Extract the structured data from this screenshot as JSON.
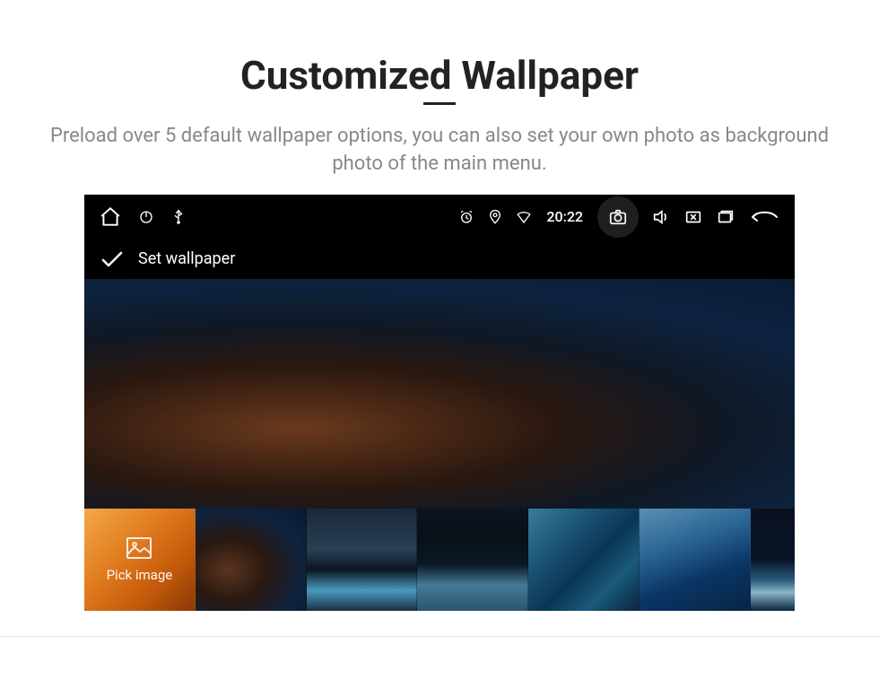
{
  "page": {
    "title": "Customized Wallpaper",
    "subtitle": "Preload over 5 default wallpaper options, you can also set your own photo as background photo of the main menu."
  },
  "status_bar": {
    "time": "20:22",
    "icons": {
      "home": "home-icon",
      "power": "power-icon",
      "usb": "usb-icon",
      "alarm": "alarm-icon",
      "location": "location-icon",
      "wifi": "wifi-icon",
      "camera": "camera-icon",
      "sound": "sound-icon",
      "close_app": "close-app-icon",
      "recent": "recent-apps-icon",
      "back": "back-icon"
    }
  },
  "app": {
    "header_title": "Set wallpaper"
  },
  "thumbnails": {
    "pick_label": "Pick image"
  }
}
